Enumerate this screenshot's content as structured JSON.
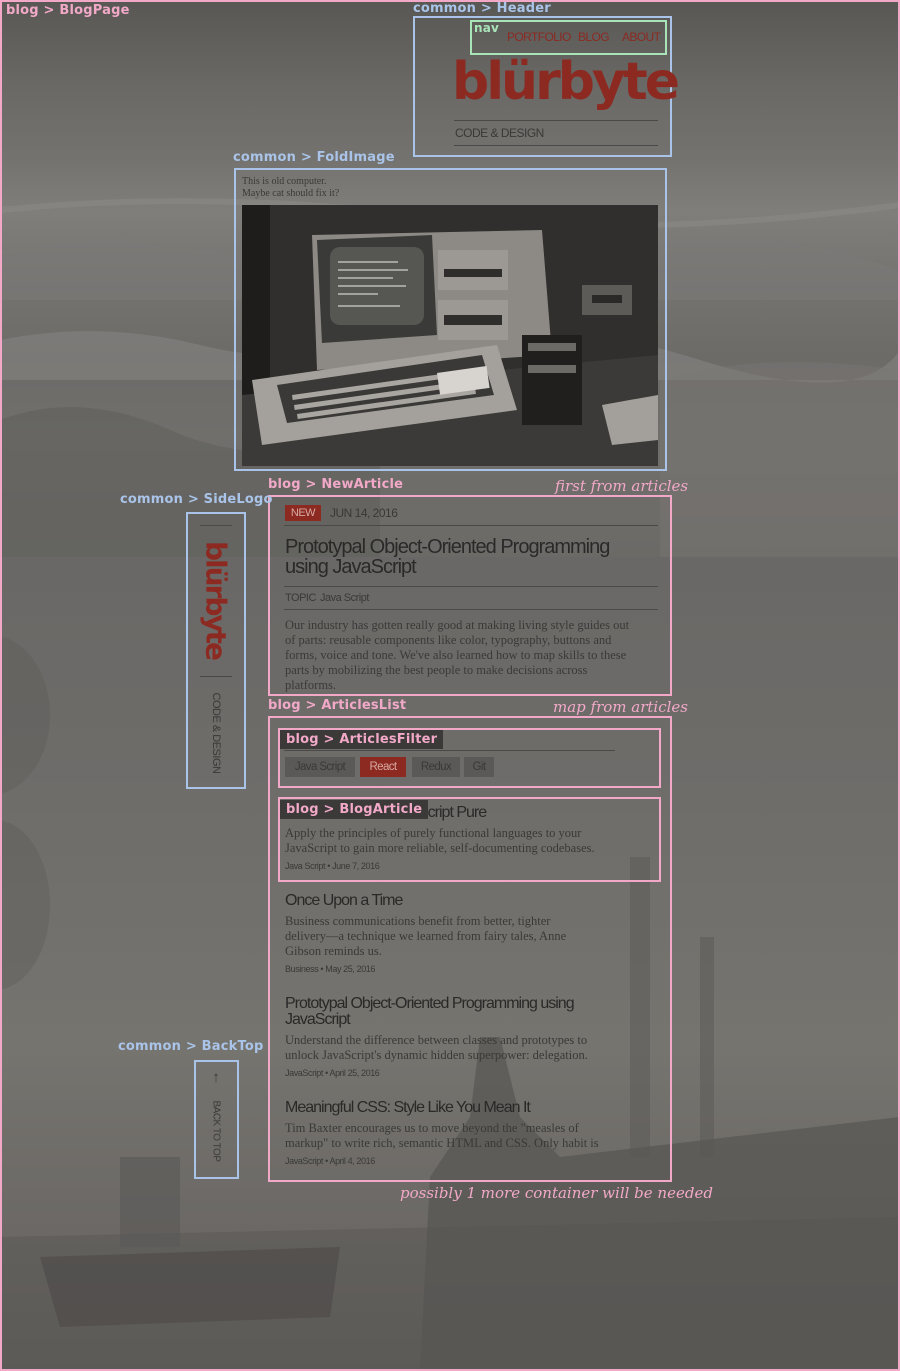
{
  "labels": {
    "blog_page": "blog > BlogPage",
    "header": "common > Header",
    "nav": "nav",
    "fold_image": "common > FoldImage",
    "side_logo": "common > SideLogo",
    "new_article": "blog > NewArticle",
    "articles_list": "blog > ArticlesList",
    "articles_filter": "blog > ArticlesFilter",
    "blog_article": "blog > BlogArticle",
    "back_top": "common > BackTop"
  },
  "notes": {
    "first_from_articles": "first from articles",
    "map_from_articles": "map from articles",
    "more_container": "possibly 1 more container will be needed"
  },
  "header": {
    "nav": [
      "PORTFOLIO",
      "BLOG",
      "ABOUT"
    ],
    "brand": "blürbyte",
    "tagline": "CODE & DESIGN"
  },
  "fold_image": {
    "caption_line1": "This is old computer.",
    "caption_line2": "Maybe cat should fix it?"
  },
  "new_article": {
    "badge": "NEW",
    "date": "JUN 14, 2016",
    "title_line1": "Prototypal Object-Oriented Programming",
    "title_line2": "using JavaScript",
    "topic_label": "TOPIC",
    "topic": "Java Script",
    "excerpt": [
      "Our industry has gotten really good at making living style guides out",
      "of parts: reusable components like color, typography, buttons and",
      "forms, voice and tone. We've also learned how to map skills to these",
      "parts by mobilizing the best people to make decisions across",
      "platforms."
    ]
  },
  "side_logo": {
    "brand": "blürbyte",
    "tagline": "CODE & DESIGN"
  },
  "filters": [
    "Java Script",
    "React",
    "Redux",
    "Git"
  ],
  "active_filter": "React",
  "articles": [
    {
      "title": "Making your JavaScript Pure",
      "title_visible": "Script Pure",
      "excerpt": [
        "Apply the principles of purely functional languages to your",
        "JavaScript to gain more reliable, self-documenting codebases."
      ],
      "meta": "Java Script • June 7, 2016"
    },
    {
      "title": "Once Upon a Time",
      "excerpt": [
        "Business communications benefit from better, tighter",
        "delivery—a technique we learned from fairy tales, Anne",
        "Gibson reminds us."
      ],
      "meta": "Business • May 25, 2016"
    },
    {
      "title_line1": "Prototypal Object-Oriented Programming using",
      "title_line2": "JavaScript",
      "excerpt": [
        "Understand the difference between classes and prototypes to",
        "unlock JavaScript's dynamic hidden superpower: delegation."
      ],
      "meta": "JavaScript • April 25, 2016"
    },
    {
      "title": "Meaningful CSS: Style Like You Mean It",
      "excerpt": [
        "Tim Baxter encourages us to move beyond the \"measles of",
        "markup\" to write rich, semantic HTML and CSS. Only habit is"
      ],
      "meta": "JavaScript • April 4, 2016"
    }
  ],
  "back_top": {
    "arrow": "↑",
    "label": "BACK TO TOP"
  },
  "colors": {
    "brand": "#8c2a22",
    "annotation_blue": "#a9c4e8",
    "annotation_pink": "#f2a9c8",
    "annotation_green": "#a9e4b8",
    "overlay": "#6a6865"
  },
  "icons": [
    "arrow-up-icon"
  ]
}
